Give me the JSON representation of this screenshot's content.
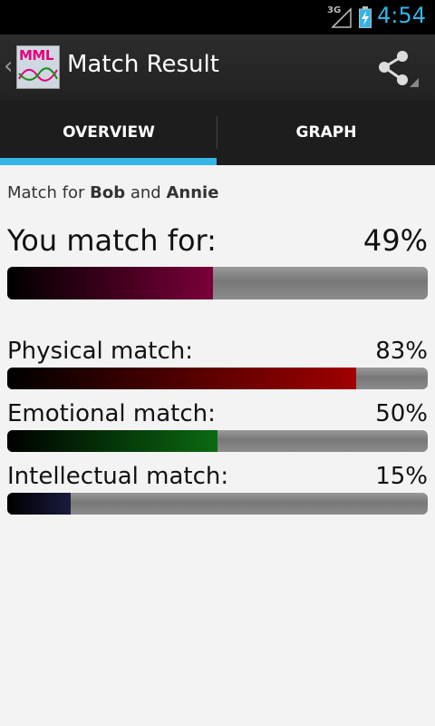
{
  "status_bar": {
    "network": "3G",
    "time": "4:54"
  },
  "action_bar": {
    "logo_text": "MML",
    "title": "Match Result"
  },
  "tabs": [
    {
      "label": "OVERVIEW",
      "selected": true
    },
    {
      "label": "GRAPH",
      "selected": false
    }
  ],
  "match_for": {
    "prefix": "Match for",
    "name1": "Bob",
    "conj": "and",
    "name2": "Annie"
  },
  "overall": {
    "label": "You match for:",
    "value": "49%",
    "percent": 49
  },
  "rows": [
    {
      "label": "Physical match:",
      "value": "83%",
      "percent": 83,
      "color": "#a00000"
    },
    {
      "label": "Emotional match:",
      "value": "50%",
      "percent": 50,
      "color": "#0a6a10"
    },
    {
      "label": "Intellectual match:",
      "value": "15%",
      "percent": 15,
      "color": "#1a1a40"
    }
  ],
  "colors": {
    "accent": "#33b5e5",
    "overall_fill": "#7a0038"
  }
}
